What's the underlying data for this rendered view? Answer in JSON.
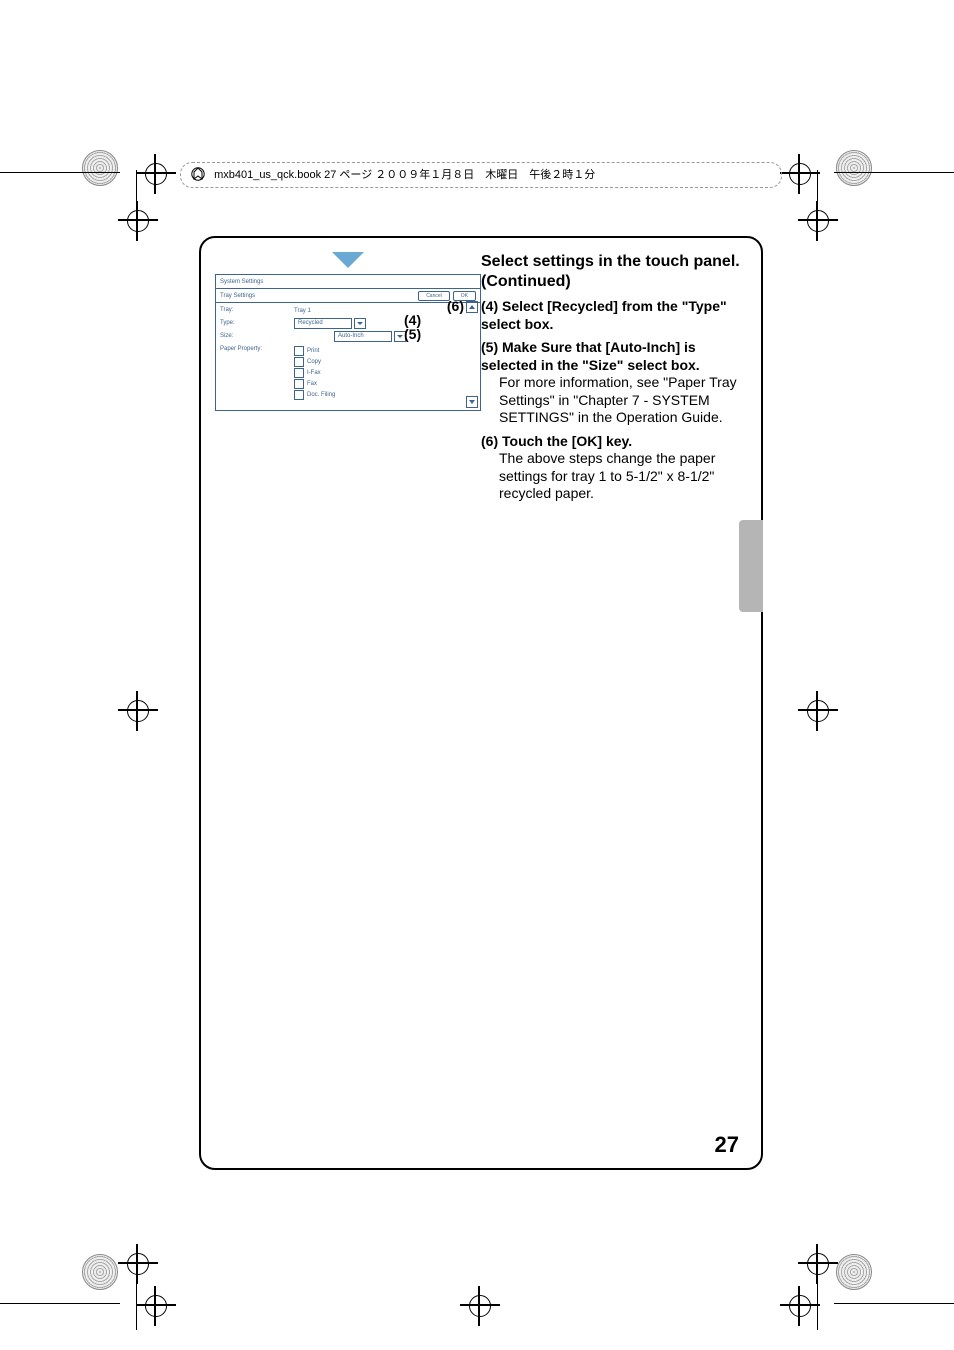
{
  "crop_header": "mxb401_us_qck.book  27 ページ  ２００９年１月８日　木曜日　午後２時１分",
  "page_number": "27",
  "heading": "Select settings in the touch panel. (Continued)",
  "steps": {
    "s4_lead": "(4) Select [Recycled] from the \"Type\" select box.",
    "s5_lead": "(5) Make Sure that [Auto-Inch] is selected in the \"Size\" select box.",
    "s5_sub": "For more information, see \"Paper Tray Settings\" in \"Chapter 7 - SYSTEM SETTINGS\" in the Operation Guide.",
    "s6_lead": "(6) Touch the [OK] key.",
    "s6_sub": "The above steps change the paper settings for tray 1 to 5-1/2\" x 8-1/2\" recycled paper."
  },
  "panel": {
    "title1": "System Settings",
    "title2": "Tray Settings",
    "cancel": "Cancel",
    "ok": "OK",
    "labels": {
      "tray": "Tray:",
      "type": "Type:",
      "size": "Size:",
      "paperprop": "Paper Property:"
    },
    "tray_value": "Tray 1",
    "type_value": "Recycled",
    "size_value": "Auto-Inch",
    "checks": [
      "Print",
      "Copy",
      "I-Fax",
      "Fax",
      "Doc. Filing"
    ]
  },
  "callouts": {
    "c4": "(4)",
    "c5": "(5)",
    "c6": "(6)"
  }
}
